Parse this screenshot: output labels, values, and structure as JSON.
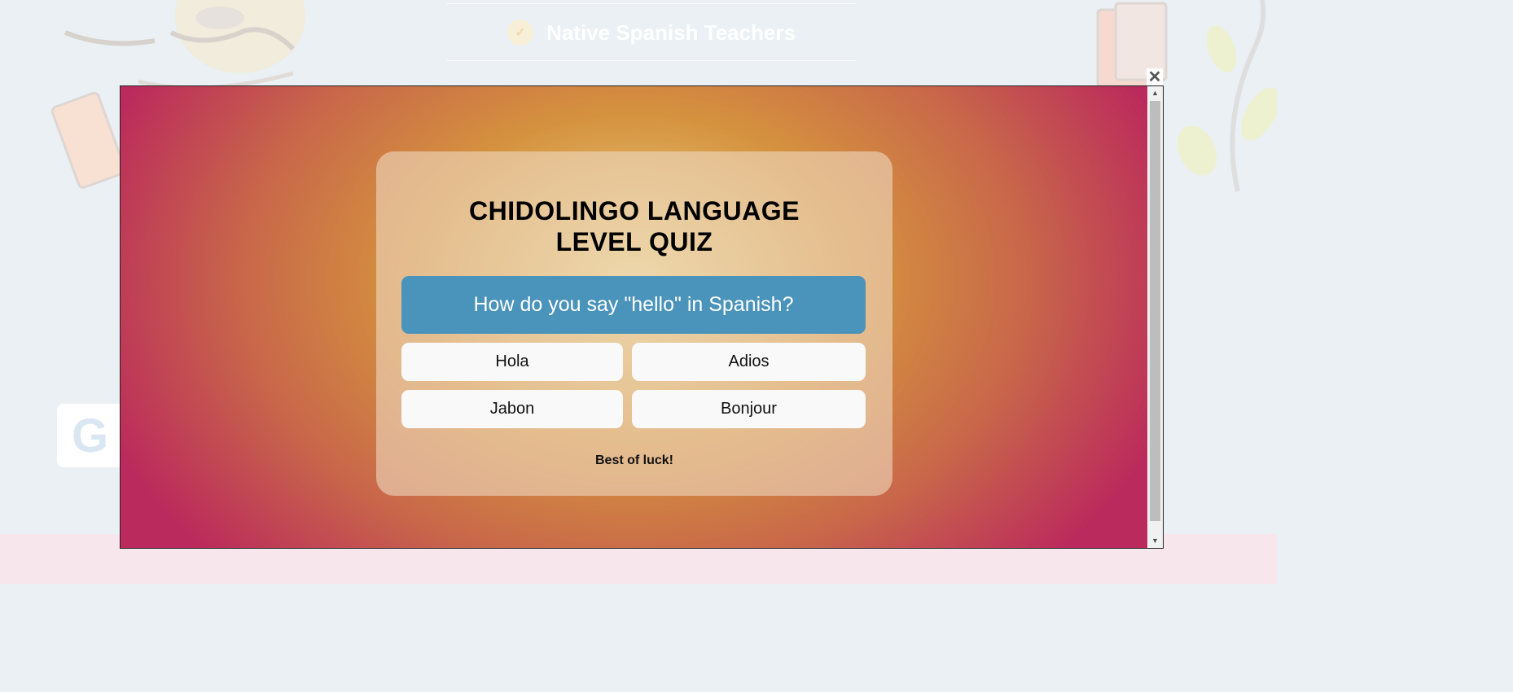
{
  "background": {
    "features": [
      {
        "label": "Native Spanish Teachers",
        "icon": "check-icon"
      }
    ],
    "google_badge_letter": "G"
  },
  "popup": {
    "close_icon": "✕",
    "scroll_up": "▲",
    "scroll_down": "▼"
  },
  "quiz": {
    "title_line1": "CHIDOLINGO LANGUAGE",
    "title_line2": "LEVEL QUIZ",
    "question": "How do you say \"hello\" in Spanish?",
    "answers": [
      "Hola",
      "Adios",
      "Jabon",
      "Bonjour"
    ],
    "footer": "Best of luck!"
  },
  "colors": {
    "question_bg": "#4a93bb",
    "gradient_center": "#ecd88a",
    "gradient_edge": "#bb2a5c"
  }
}
